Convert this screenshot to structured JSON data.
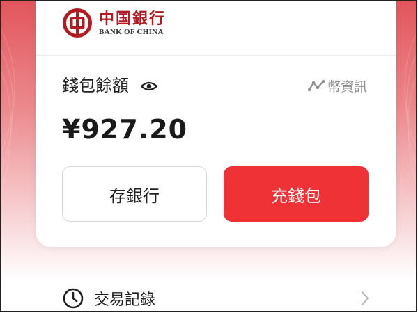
{
  "brand": {
    "name_cn": "中国銀行",
    "name_en": "BANK OF CHINA",
    "logo_icon": "bank-of-china-logo",
    "color": "#b11b21"
  },
  "wallet": {
    "label": "錢包餘額",
    "visibility_icon": "eye-icon",
    "info_link": "幣資訊",
    "info_icon": "trend-line-icon",
    "balance": "¥927.20"
  },
  "actions": {
    "deposit_label": "存銀行",
    "topup_label": "充錢包",
    "topup_color": "#ef3235"
  },
  "menu": {
    "history_label": "交易記錄",
    "history_icon": "clock-icon",
    "chevron_icon": "chevron-right-icon"
  }
}
